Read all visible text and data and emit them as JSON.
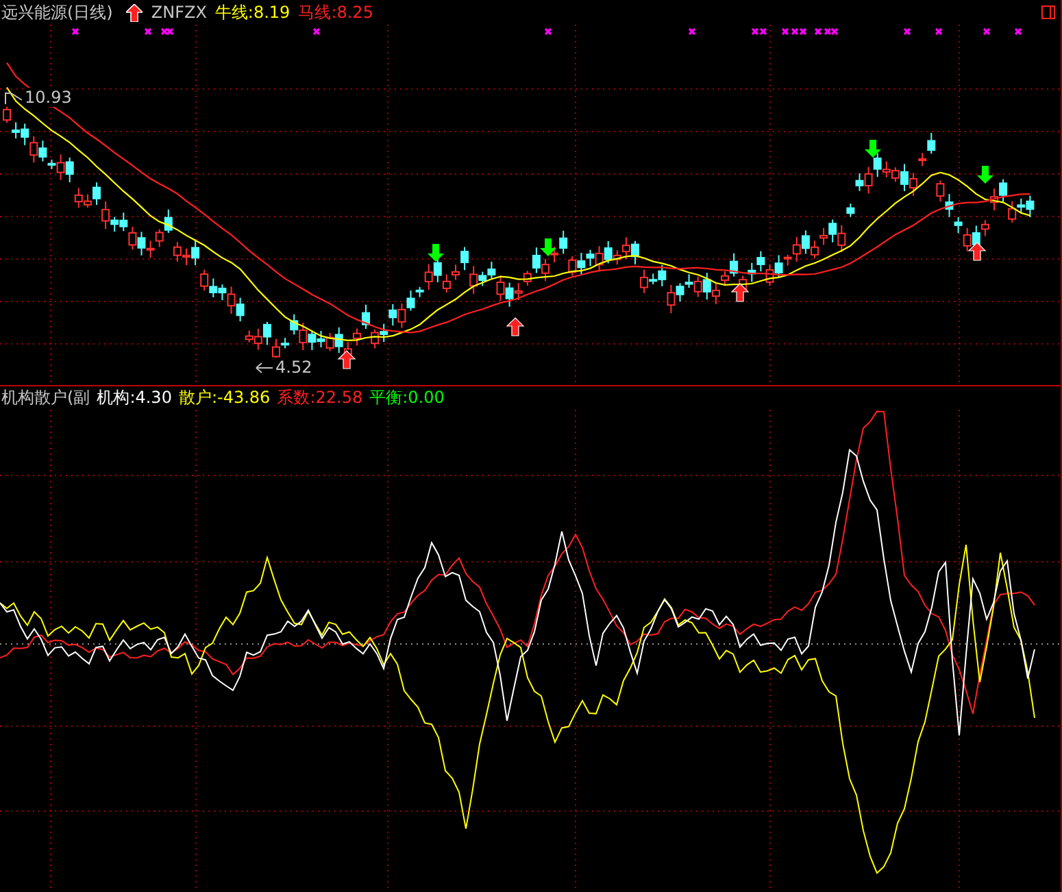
{
  "main_chart": {
    "title": "远兴能源(日线)",
    "formula": "ZNFZX",
    "indicators": [
      {
        "label": "牛线:8.19",
        "color": "#ffff00"
      },
      {
        "label": "马线:8.25",
        "color": "#ff2020"
      }
    ],
    "price_labels": [
      {
        "text": "10.93",
        "kind": "high"
      },
      {
        "text": "4.52",
        "kind": "low"
      }
    ]
  },
  "sub_chart": {
    "title": "机构散户(副",
    "indicators": [
      {
        "label": "机构:4.30",
        "color": "#ffffff"
      },
      {
        "label": "散户:-43.86",
        "color": "#ffff00"
      },
      {
        "label": "系数:22.58",
        "color": "#ff2020"
      },
      {
        "label": "平衡:0.00",
        "color": "#00ff00"
      }
    ]
  }
}
